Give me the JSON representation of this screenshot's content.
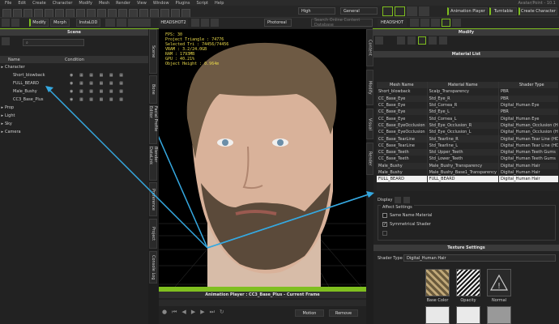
{
  "menubar": {
    "items": [
      "File",
      "Edit",
      "Create",
      "Character",
      "Modify",
      "Mesh",
      "Render",
      "View",
      "Window",
      "Plugins",
      "Script",
      "Help"
    ],
    "app_title": "Avatar/Point - 10.1"
  },
  "toolbar": {
    "quality": "High",
    "general": "General",
    "animation_player": "Animation Player",
    "turntable": "Turntable",
    "create_character": "Create Character",
    "headshot": "HEADSHOT",
    "headshot2": "HEADSHOT2",
    "modify_label": "Modify",
    "morph_label": "Morph",
    "instalod_label": "InstaLOD",
    "photoreal": "Photoreal",
    "search_placeholder": "Search Online Content Database"
  },
  "scene": {
    "title": "Scene",
    "col_name": "Name",
    "col_condition": "Condition",
    "items": [
      {
        "label": "Character",
        "indent": 0
      },
      {
        "label": "Short_blowback",
        "indent": 1
      },
      {
        "label": "FULL_BEARD",
        "indent": 1
      },
      {
        "label": "Male_Bushy",
        "indent": 1
      },
      {
        "label": "CC3_Base_Plus",
        "indent": 1
      },
      {
        "label": "Prop",
        "indent": 0
      },
      {
        "label": "Light",
        "indent": 0
      },
      {
        "label": "Sky",
        "indent": 0
      },
      {
        "label": "Camera",
        "indent": 0
      }
    ]
  },
  "left_tabs": [
    "Scene",
    "Bone",
    "Facial Profile Editor",
    "Blender DataLink",
    "Preference",
    "Project",
    "Console Log"
  ],
  "right_tabs": [
    "Content",
    "Modify",
    "Visual",
    "Render"
  ],
  "viewport": {
    "stats": [
      "FPS: 30",
      "Project Triangle : 74776",
      "Selected Tri : 74456/74456",
      "VRAM : 3.2/24.0GB",
      "RAM : 1793MB",
      "GPU : 40.21%",
      "Object Height : 0.964m"
    ]
  },
  "anim_player": {
    "title": "Animation Player : CC3_Base_Plus - Current Frame",
    "motion": "Motion",
    "remove": "Remove"
  },
  "modify": {
    "title": "Modify",
    "material_list_title": "Material List",
    "columns": [
      "Mesh Name",
      "Material Name",
      "Shader Type"
    ],
    "rows": [
      [
        "Short_blowback",
        "Scalp_Transparency",
        "PBR"
      ],
      [
        "CC_Base_Eye",
        "Std_Eye_R",
        "PBR"
      ],
      [
        "CC_Base_Eye",
        "Std_Cornea_R",
        "Digital_Human Eye"
      ],
      [
        "CC_Base_Eye",
        "Std_Eye_L",
        "PBR"
      ],
      [
        "CC_Base_Eye",
        "Std_Cornea_L",
        "Digital_Human Eye"
      ],
      [
        "CC_Base_EyeOcclusion",
        "Std_Eye_Occlusion_R",
        "Digital_Human_Occlusion (HD)"
      ],
      [
        "CC_Base_EyeOcclusion",
        "Std_Eye_Occlusion_L",
        "Digital_Human_Occlusion (HD)"
      ],
      [
        "CC_Base_TearLine",
        "Std_Tearline_R",
        "Digital_Human Tear Line (HD)"
      ],
      [
        "CC_Base_TearLine",
        "Std_Tearline_L",
        "Digital_Human Tear Line (HD)"
      ],
      [
        "CC_Base_Teeth",
        "Std_Upper_Teeth",
        "Digital_Human Teeth Gums"
      ],
      [
        "CC_Base_Teeth",
        "Std_Lower_Teeth",
        "Digital_Human Teeth Gums"
      ],
      [
        "Male_Bushy",
        "Male_Bushy_Transparency",
        "Digital_Human Hair"
      ],
      [
        "Male_Bushy",
        "Male_Bushy_Base1_Transparency",
        "Digital_Human Hair"
      ],
      [
        "FULL_BEARD",
        "FULL_BEARD",
        "Digital_Human Hair"
      ]
    ],
    "selected_row": 13,
    "display_label": "Display",
    "affect_settings": "Affect Settings",
    "same_name_material": "Same Name Material",
    "symmetrical_shader": "Symmetrical Shader",
    "texture_settings_title": "Texture Settings",
    "shader_type_label": "Shader Type",
    "shader_type_value": "Digital_Human Hair",
    "textures": [
      "Base Color",
      "Opacity",
      "Normal"
    ]
  }
}
